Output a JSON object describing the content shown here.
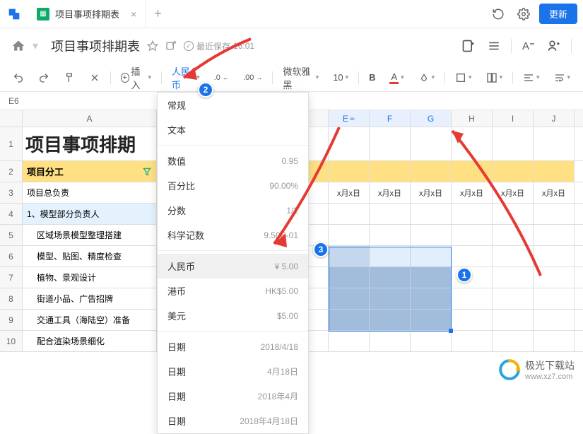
{
  "titlebar": {
    "tab_title": "项目事项排期表",
    "update_label": "更新"
  },
  "doc": {
    "title": "项目事项排期表",
    "save_prefix": "最近保存",
    "save_time": "16:01"
  },
  "toolbar": {
    "insert": "插入",
    "currency": "人民币",
    "decimal_dec": ".0",
    "decimal_inc": ".00",
    "font": "微软雅黑",
    "font_size": "10",
    "bold": "B",
    "font_color": "A"
  },
  "refbar": {
    "cell": "E6"
  },
  "columns": [
    "A",
    "E",
    "F",
    "G",
    "H",
    "I",
    "J"
  ],
  "rows": {
    "r1_title": "项目事项排期",
    "r2_a": "项目分工",
    "r3_a": "项目总负责",
    "r3_dates": [
      "x月x日",
      "x月x日",
      "x月x日",
      "x月x日",
      "x月x日",
      "x月x日"
    ],
    "r4_a": "1、模型部分负责人",
    "r5_a": "区域场景模型整理搭建",
    "r6_a": "模型、贴图、精度检查",
    "r7_a": "植物、景观设计",
    "r8_a": "街道小品、广告招牌",
    "r9_a": "交通工具（海陆空）准备",
    "r10_a": "配合渲染场景细化"
  },
  "dropdown": {
    "items": [
      {
        "label": "常规",
        "value": ""
      },
      {
        "label": "文本",
        "value": ""
      },
      {
        "label": "数值",
        "value": "0.95"
      },
      {
        "label": "百分比",
        "value": "90.00%"
      },
      {
        "label": "分数",
        "value": "1/2"
      },
      {
        "label": "科学记数",
        "value": "9.50E-01"
      },
      {
        "label": "人民币",
        "value": "¥ 5.00"
      },
      {
        "label": "港币",
        "value": "HK$5.00"
      },
      {
        "label": "美元",
        "value": "$5.00"
      },
      {
        "label": "日期",
        "value": "2018/4/18"
      },
      {
        "label": "日期",
        "value": "4月18日"
      },
      {
        "label": "日期",
        "value": "2018年4月"
      },
      {
        "label": "日期",
        "value": "2018年4月18日"
      }
    ]
  },
  "watermark": {
    "name": "极光下载站",
    "url": "www.xz7.com"
  },
  "badges": [
    "1",
    "2",
    "3"
  ]
}
